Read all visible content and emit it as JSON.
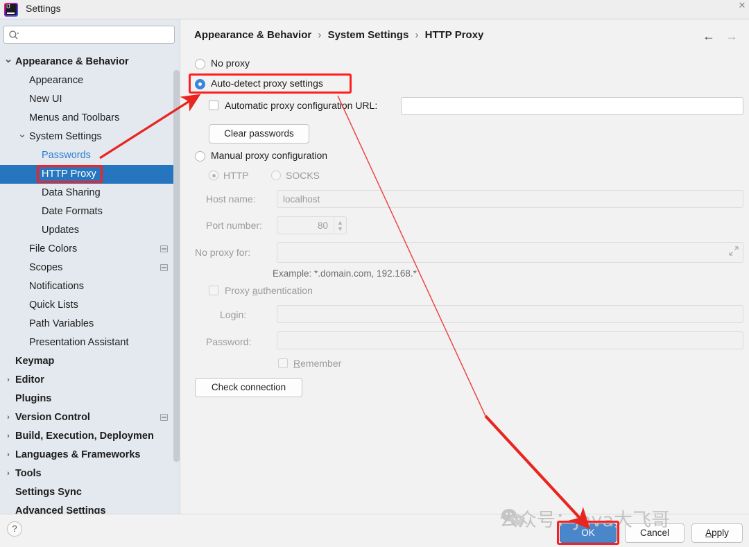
{
  "window": {
    "title": "Settings",
    "logo_icon": "intellij-idea-logo",
    "close_icon": "close-icon"
  },
  "search": {
    "value": "",
    "placeholder": "",
    "icon": "search-icon"
  },
  "sidebar": {
    "items": [
      {
        "label": "Appearance & Behavior",
        "indent": 22,
        "bold": true,
        "chevron": "down",
        "selected": false,
        "link": false,
        "badge": false
      },
      {
        "label": "Appearance",
        "indent": 42,
        "bold": false,
        "chevron": "",
        "selected": false,
        "link": false,
        "badge": false
      },
      {
        "label": "New UI",
        "indent": 42,
        "bold": false,
        "chevron": "",
        "selected": false,
        "link": false,
        "badge": false
      },
      {
        "label": "Menus and Toolbars",
        "indent": 42,
        "bold": false,
        "chevron": "",
        "selected": false,
        "link": false,
        "badge": false
      },
      {
        "label": "System Settings",
        "indent": 42,
        "bold": false,
        "chevron": "down",
        "selected": false,
        "link": false,
        "badge": false
      },
      {
        "label": "Passwords",
        "indent": 60,
        "bold": false,
        "chevron": "",
        "selected": false,
        "link": true,
        "badge": false
      },
      {
        "label": "HTTP Proxy",
        "indent": 60,
        "bold": false,
        "chevron": "",
        "selected": true,
        "link": false,
        "badge": false
      },
      {
        "label": "Data Sharing",
        "indent": 60,
        "bold": false,
        "chevron": "",
        "selected": false,
        "link": false,
        "badge": false
      },
      {
        "label": "Date Formats",
        "indent": 60,
        "bold": false,
        "chevron": "",
        "selected": false,
        "link": false,
        "badge": false
      },
      {
        "label": "Updates",
        "indent": 60,
        "bold": false,
        "chevron": "",
        "selected": false,
        "link": false,
        "badge": false
      },
      {
        "label": "File Colors",
        "indent": 42,
        "bold": false,
        "chevron": "",
        "selected": false,
        "link": false,
        "badge": true
      },
      {
        "label": "Scopes",
        "indent": 42,
        "bold": false,
        "chevron": "",
        "selected": false,
        "link": false,
        "badge": true
      },
      {
        "label": "Notifications",
        "indent": 42,
        "bold": false,
        "chevron": "",
        "selected": false,
        "link": false,
        "badge": false
      },
      {
        "label": "Quick Lists",
        "indent": 42,
        "bold": false,
        "chevron": "",
        "selected": false,
        "link": false,
        "badge": false
      },
      {
        "label": "Path Variables",
        "indent": 42,
        "bold": false,
        "chevron": "",
        "selected": false,
        "link": false,
        "badge": false
      },
      {
        "label": "Presentation Assistant",
        "indent": 42,
        "bold": false,
        "chevron": "",
        "selected": false,
        "link": false,
        "badge": false
      },
      {
        "label": "Keymap",
        "indent": 22,
        "bold": true,
        "chevron": "",
        "selected": false,
        "link": false,
        "badge": false
      },
      {
        "label": "Editor",
        "indent": 22,
        "bold": true,
        "chevron": "right",
        "selected": false,
        "link": false,
        "badge": false
      },
      {
        "label": "Plugins",
        "indent": 22,
        "bold": true,
        "chevron": "",
        "selected": false,
        "link": false,
        "badge": false
      },
      {
        "label": "Version Control",
        "indent": 22,
        "bold": true,
        "chevron": "right",
        "selected": false,
        "link": false,
        "badge": true
      },
      {
        "label": "Build, Execution, Deploymen",
        "indent": 22,
        "bold": true,
        "chevron": "right",
        "selected": false,
        "link": false,
        "badge": false
      },
      {
        "label": "Languages & Frameworks",
        "indent": 22,
        "bold": true,
        "chevron": "right",
        "selected": false,
        "link": false,
        "badge": false
      },
      {
        "label": "Tools",
        "indent": 22,
        "bold": true,
        "chevron": "right",
        "selected": false,
        "link": false,
        "badge": false
      },
      {
        "label": "Settings Sync",
        "indent": 22,
        "bold": true,
        "chevron": "",
        "selected": false,
        "link": false,
        "badge": false
      },
      {
        "label": "Advanced Settings",
        "indent": 22,
        "bold": true,
        "chevron": "",
        "selected": false,
        "link": false,
        "badge": false
      }
    ]
  },
  "breadcrumb": {
    "part1": "Appearance & Behavior",
    "part2": "System Settings",
    "part3": "HTTP Proxy",
    "separator": "›",
    "back_icon": "arrow-left-icon",
    "forward_icon": "arrow-right-icon"
  },
  "proxy": {
    "no_proxy_label": "No proxy",
    "no_proxy_checked": false,
    "auto_detect_label": "Auto-detect proxy settings",
    "auto_detect_checked": true,
    "auto_config_url_label": "Automatic proxy configuration URL:",
    "auto_config_url_checked": false,
    "auto_config_url_value": "",
    "clear_passwords_label": "Clear passwords",
    "manual_label": "Manual proxy configuration",
    "manual_checked": false,
    "http_label": "HTTP",
    "http_checked": true,
    "socks_label": "SOCKS",
    "socks_checked": false,
    "host_name_label": "Host name:",
    "host_name_value": "localhost",
    "port_number_label": "Port number:",
    "port_number_value": "80",
    "no_proxy_for_label": "No proxy for:",
    "no_proxy_for_value": "",
    "example_text": "Example: *.domain.com, 192.168.*",
    "proxy_auth_label": "Proxy authentication",
    "proxy_auth_mnemonic": "a",
    "proxy_auth_checked": false,
    "login_label": "Login:",
    "login_value": "",
    "password_label": "Password:",
    "password_value": "",
    "remember_label": "Remember",
    "remember_mnemonic": "R",
    "remember_checked": false,
    "check_connection_label": "Check connection",
    "expand_icon": "expand-icon",
    "spinner_up_icon": "chevron-up-icon",
    "spinner_down_icon": "chevron-down-icon"
  },
  "dialog_buttons": {
    "ok": "OK",
    "cancel": "Cancel",
    "apply_mnemonic": "A",
    "apply_rest": "pply",
    "help_icon": "question-mark-icon"
  },
  "watermark": {
    "text": "公众号：Java大飞哥",
    "icon": "wechat-icon"
  },
  "annotations": {
    "highlight_color": "#ff1d1d",
    "arrow_color": "#e8251e",
    "boxes": [
      "auto-detect-radio-highlight",
      "http-proxy-sidebar-highlight",
      "ok-button-highlight"
    ],
    "arrows": [
      "sidebar-to-auto-detect-arrow",
      "auto-detect-to-ok-arrow"
    ]
  }
}
